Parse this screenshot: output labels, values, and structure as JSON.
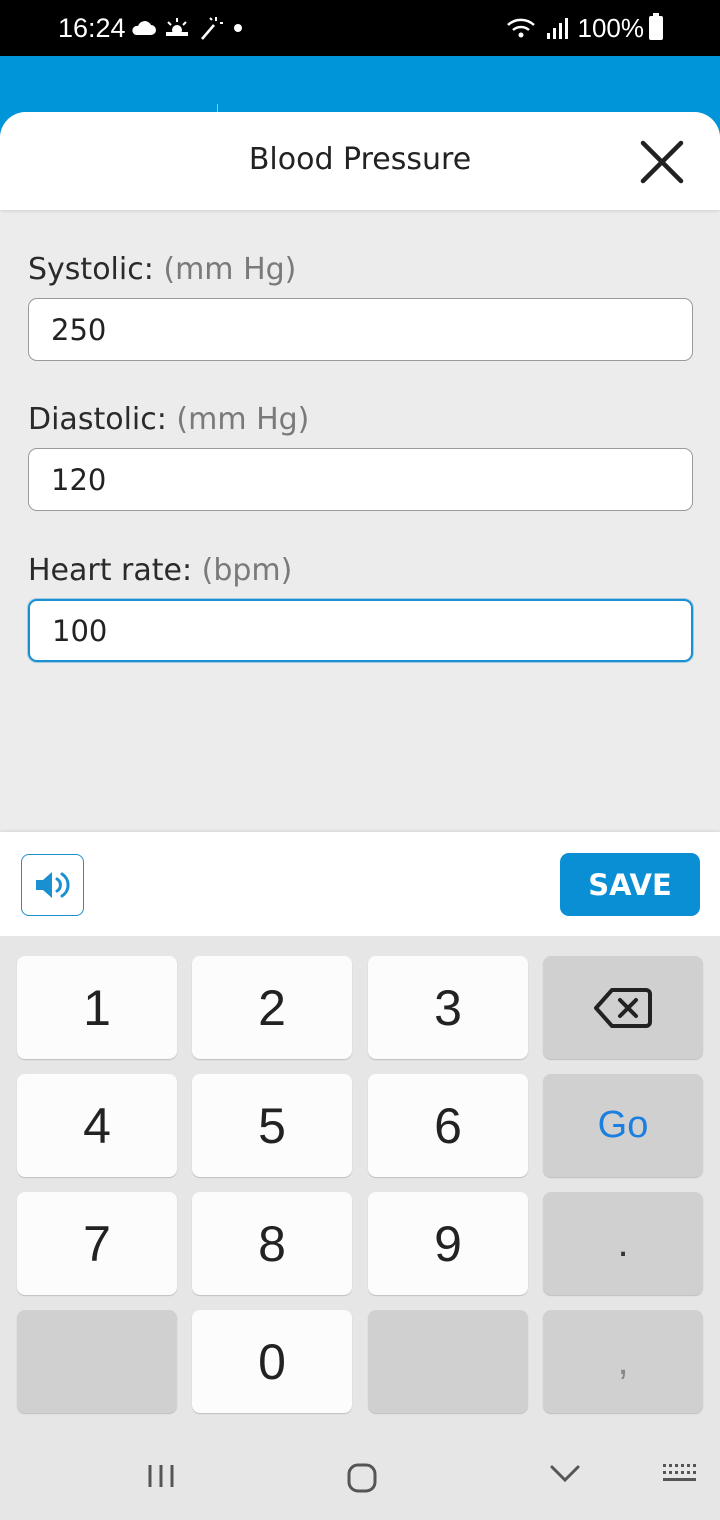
{
  "status_bar": {
    "time": "16:24",
    "battery": "100%",
    "icons": [
      "cloud-icon",
      "sunrise-icon",
      "magic-wand-icon",
      "dot-icon",
      "wifi-icon",
      "signal-icon",
      "battery-icon"
    ]
  },
  "dialog": {
    "title": "Blood Pressure",
    "close_icon": "close-icon"
  },
  "fields": {
    "systolic": {
      "label": "Systolic:",
      "unit": "(mm Hg)",
      "value": "250"
    },
    "diastolic": {
      "label": "Diastolic:",
      "unit": "(mm Hg)",
      "value": "120"
    },
    "heart_rate": {
      "label": "Heart rate:",
      "unit": "(bpm)",
      "value": "100"
    }
  },
  "actions": {
    "speaker_icon": "speaker-icon",
    "save_label": "SAVE"
  },
  "keyboard": {
    "keys": [
      "1",
      "2",
      "3",
      "4",
      "5",
      "6",
      "7",
      "8",
      "9",
      "0"
    ],
    "go_label": "Go",
    "period": ".",
    "comma": ",",
    "backspace_icon": "backspace-icon"
  },
  "nav_bar": {
    "icons": [
      "recent-apps-icon",
      "home-icon",
      "back-icon",
      "keyboard-switch-icon"
    ]
  },
  "colors": {
    "accent": "#0095d9",
    "save_button": "#0a8fd4",
    "go_key": "#1a7fe0"
  }
}
